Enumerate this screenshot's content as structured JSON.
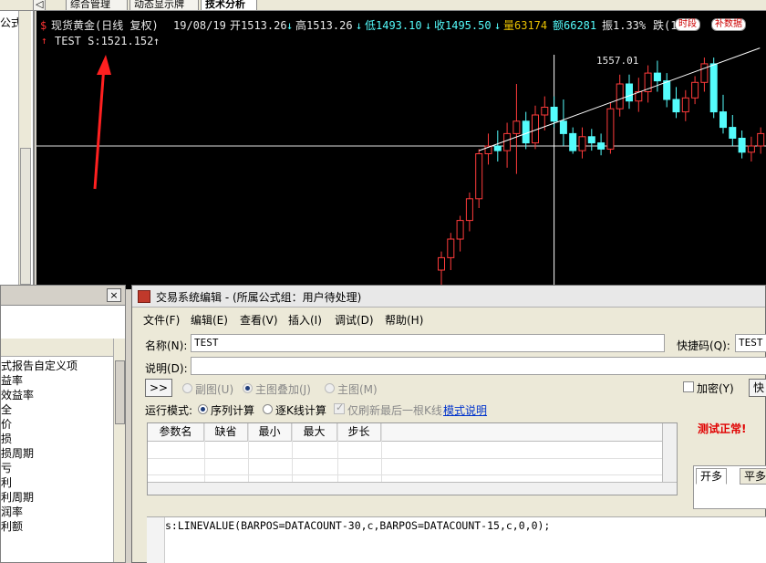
{
  "tabs": {
    "nav_left": "◁",
    "items": [
      "综合管理",
      "动态显示牌",
      "技术分析"
    ]
  },
  "left_panel": {
    "title": "公式"
  },
  "chart": {
    "header": {
      "symbol_badge": "$",
      "symbol_name": "现货黄金(日线 复权)",
      "date": "19/08/19",
      "open": "开1513.26",
      "open_arrow": "↓",
      "high": "高1513.26",
      "high_arrow": "↓",
      "low": "低1493.10",
      "low_arrow": "↓",
      "close": "收1495.50",
      "close_arrow": "↓",
      "volume": "量63174",
      "amount": "额66281",
      "amplitude": "振1.33%",
      "change": "跌(1"
    },
    "buttons": {
      "timeline": "时段",
      "supplement": "补数据"
    },
    "indicator": {
      "badge": "↑",
      "text": "TEST S:1521.152",
      "arrow": "↑"
    },
    "peak_label": "1557.01",
    "colors": {
      "up": "#ff3b3b",
      "down": "#54fcfc",
      "trend_line": "#ffffff",
      "crosshair": "#ffffff",
      "arrow": "#ff2020"
    }
  },
  "chart_data": {
    "type": "candlestick",
    "title": "现货黄金(日线 复权)",
    "y_visible_range": [
      1395,
      1565
    ],
    "candles": [
      {
        "open": 1420,
        "high": 1432,
        "low": 1398,
        "close": 1428
      },
      {
        "open": 1428,
        "high": 1444,
        "low": 1420,
        "close": 1440
      },
      {
        "open": 1440,
        "high": 1455,
        "low": 1432,
        "close": 1452
      },
      {
        "open": 1452,
        "high": 1470,
        "low": 1445,
        "close": 1466
      },
      {
        "open": 1466,
        "high": 1498,
        "low": 1460,
        "close": 1495
      },
      {
        "open": 1495,
        "high": 1508,
        "low": 1488,
        "close": 1500
      },
      {
        "open": 1500,
        "high": 1510,
        "low": 1490,
        "close": 1497
      },
      {
        "open": 1497,
        "high": 1515,
        "low": 1486,
        "close": 1508
      },
      {
        "open": 1508,
        "high": 1540,
        "low": 1482,
        "close": 1516
      },
      {
        "open": 1516,
        "high": 1522,
        "low": 1498,
        "close": 1502
      },
      {
        "open": 1502,
        "high": 1526,
        "low": 1498,
        "close": 1520
      },
      {
        "open": 1520,
        "high": 1532,
        "low": 1510,
        "close": 1525
      },
      {
        "open": 1525,
        "high": 1532,
        "low": 1512,
        "close": 1516
      },
      {
        "open": 1516,
        "high": 1530,
        "low": 1500,
        "close": 1508
      },
      {
        "open": 1508,
        "high": 1512,
        "low": 1495,
        "close": 1497
      },
      {
        "open": 1497,
        "high": 1512,
        "low": 1492,
        "close": 1506
      },
      {
        "open": 1506,
        "high": 1511,
        "low": 1497,
        "close": 1502
      },
      {
        "open": 1502,
        "high": 1508,
        "low": 1494,
        "close": 1498
      },
      {
        "open": 1498,
        "high": 1528,
        "low": 1495,
        "close": 1524
      },
      {
        "open": 1524,
        "high": 1546,
        "low": 1519,
        "close": 1540
      },
      {
        "open": 1540,
        "high": 1546,
        "low": 1524,
        "close": 1529
      },
      {
        "open": 1529,
        "high": 1544,
        "low": 1522,
        "close": 1535
      },
      {
        "open": 1535,
        "high": 1552,
        "low": 1528,
        "close": 1547
      },
      {
        "open": 1547,
        "high": 1555,
        "low": 1535,
        "close": 1542
      },
      {
        "open": 1542,
        "high": 1547,
        "low": 1525,
        "close": 1530
      },
      {
        "open": 1530,
        "high": 1538,
        "low": 1518,
        "close": 1522
      },
      {
        "open": 1522,
        "high": 1536,
        "low": 1516,
        "close": 1531
      },
      {
        "open": 1531,
        "high": 1545,
        "low": 1527,
        "close": 1541
      },
      {
        "open": 1541,
        "high": 1557,
        "low": 1535,
        "close": 1553
      },
      {
        "open": 1553,
        "high": 1557,
        "low": 1518,
        "close": 1522
      },
      {
        "open": 1522,
        "high": 1533,
        "low": 1508,
        "close": 1512
      },
      {
        "open": 1512,
        "high": 1520,
        "low": 1500,
        "close": 1505
      },
      {
        "open": 1505,
        "high": 1510,
        "low": 1492,
        "close": 1496
      },
      {
        "open": 1496,
        "high": 1506,
        "low": 1490,
        "close": 1500
      },
      {
        "open": 1500,
        "high": 1512,
        "low": 1495,
        "close": 1508
      },
      {
        "open": 1508,
        "high": 1512,
        "low": 1498,
        "close": 1502
      },
      {
        "open": 1502,
        "high": 1509,
        "low": 1494,
        "close": 1498
      },
      {
        "open": 1498,
        "high": 1514,
        "low": 1495,
        "close": 1510
      }
    ],
    "trend_line": {
      "from_candle": 4,
      "from_value": 1497,
      "to_candle": 31,
      "to_value": 1562
    },
    "horizontal_line": 1500,
    "crosshair_candle": 12
  },
  "left_dialog": {
    "close": "×",
    "items": [
      "式报告自定义项",
      "益率",
      "效益率",
      "全",
      "价",
      "损",
      "损周期",
      "亏",
      "利",
      "利周期",
      "润率",
      "利额"
    ]
  },
  "dialog": {
    "title": "交易系统编辑 - (所属公式组：用户待处理)",
    "menu": [
      "文件(F)",
      "编辑(E)",
      "查看(V)",
      "插入(I)",
      "调试(D)",
      "帮助(H)"
    ],
    "name_label": "名称(N):",
    "name_value": "TEST",
    "shortcut_label": "快捷码(Q):",
    "shortcut_value": "TEST",
    "desc_label": "说明(D):",
    "expand_btn": ">>",
    "radio_subchart": "副图(U)",
    "radio_overlay": "主图叠加(J)",
    "radio_main": "主图(M)",
    "encrypt_label": "加密(Y)",
    "fast_btn": "快",
    "mode_label": "运行模式:",
    "mode_sequence": "序列计算",
    "mode_per_k": "逐K线计算",
    "refresh_last": "仅刷新最后一根K线",
    "mode_help": "模式说明",
    "grid_headers": [
      "参数名",
      "缺省",
      "最小",
      "最大",
      "步长"
    ],
    "test_status": "测试正常!",
    "side_tabs": [
      "开多",
      "平多"
    ],
    "code": "s:LINEVALUE(BARPOS=DATACOUNT-30,c,BARPOS=DATACOUNT-15,c,0,0);",
    "test_color": "#e00000"
  }
}
